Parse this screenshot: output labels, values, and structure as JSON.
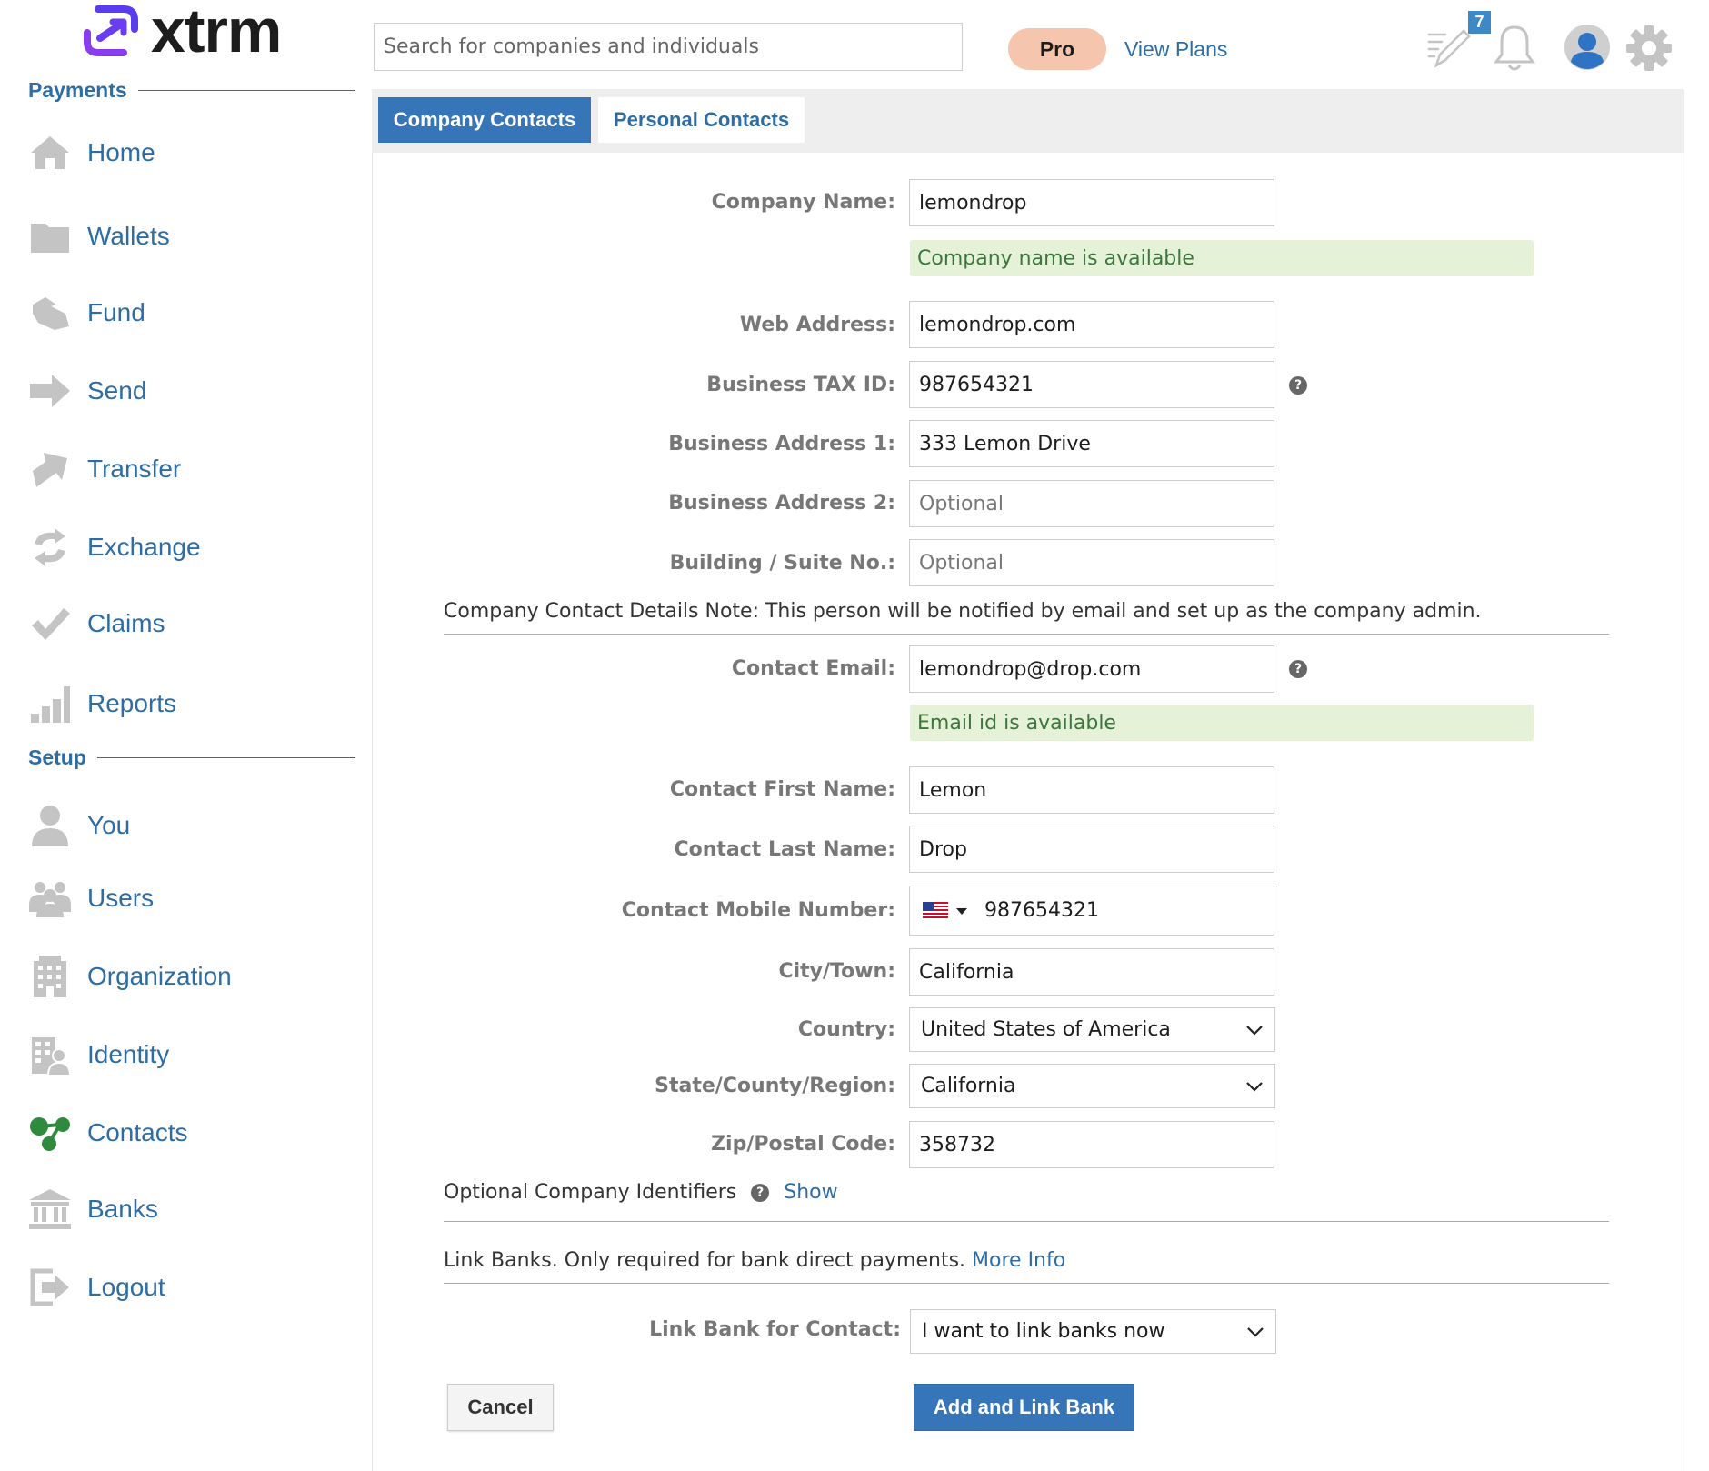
{
  "brand": {
    "name": "xtrm",
    "accent": "#2e6da4",
    "logo_color": "#6a3df0"
  },
  "sidebar": {
    "payments_heading": "Payments",
    "setup_heading": "Setup",
    "payments_items": [
      {
        "label": "Home",
        "icon": "home-icon"
      },
      {
        "label": "Wallets",
        "icon": "folder-icon"
      },
      {
        "label": "Fund",
        "icon": "fund-icon"
      },
      {
        "label": "Send",
        "icon": "send-arrow-icon"
      },
      {
        "label": "Transfer",
        "icon": "transfer-arrow-icon"
      },
      {
        "label": "Exchange",
        "icon": "exchange-icon"
      },
      {
        "label": "Claims",
        "icon": "checkmark-icon"
      },
      {
        "label": "Reports",
        "icon": "bar-chart-icon"
      }
    ],
    "setup_items": [
      {
        "label": "You",
        "icon": "user-icon"
      },
      {
        "label": "Users",
        "icon": "users-icon"
      },
      {
        "label": "Organization",
        "icon": "building-icon"
      },
      {
        "label": "Identity",
        "icon": "identity-icon"
      },
      {
        "label": "Contacts",
        "icon": "contacts-icon",
        "active": true
      },
      {
        "label": "Banks",
        "icon": "bank-icon"
      },
      {
        "label": "Logout",
        "icon": "logout-icon"
      }
    ]
  },
  "header": {
    "search_placeholder": "Search for companies and individuals",
    "plan_label": "Pro",
    "view_plans": "View Plans",
    "notification_count": "7",
    "icons": [
      "edit-notes-icon",
      "bell-icon",
      "profile-icon",
      "gear-icon"
    ]
  },
  "tabs": [
    {
      "label": "Company Contacts",
      "active": true
    },
    {
      "label": "Personal Contacts",
      "active": false
    }
  ],
  "form": {
    "company_name": {
      "label": "Company Name:",
      "value": "lemondrop"
    },
    "company_available": "Company name is available",
    "web_address": {
      "label": "Web Address:",
      "value": "lemondrop.com"
    },
    "tax_id": {
      "label": "Business TAX ID:",
      "value": "987654321"
    },
    "address1": {
      "label": "Business Address 1:",
      "value": "333 Lemon Drive"
    },
    "address2": {
      "label": "Business Address 2:",
      "placeholder": "Optional"
    },
    "suite": {
      "label": "Building / Suite No.:",
      "placeholder": "Optional"
    },
    "contact_details_note": "Company Contact Details  Note: This person will be notified by email and set up as the company admin.",
    "contact_email": {
      "label": "Contact Email:",
      "value": "lemondrop@drop.com"
    },
    "email_available": "Email id is available",
    "first_name": {
      "label": "Contact First Name:",
      "value": "Lemon"
    },
    "last_name": {
      "label": "Contact Last Name:",
      "value": "Drop"
    },
    "mobile": {
      "label": "Contact Mobile Number:",
      "value": "987654321",
      "flag_icon": "us-flag-icon"
    },
    "city": {
      "label": "City/Town:",
      "value": "California"
    },
    "country": {
      "label": "Country:",
      "value": "United States of America"
    },
    "state": {
      "label": "State/County/Region:",
      "value": "California"
    },
    "zip": {
      "label": "Zip/Postal Code:",
      "value": "358732"
    },
    "optional_identifiers": {
      "text": "Optional Company Identifiers",
      "link": "Show"
    },
    "link_banks": {
      "text": "Link Banks. Only required for bank direct payments.",
      "link": "More Info"
    },
    "link_bank_for_contact": {
      "label": "Link Bank for Contact:",
      "value": "I want to link banks now"
    },
    "cancel": "Cancel",
    "submit": "Add and Link Bank"
  },
  "colors": {
    "available_bg": "#e5f2d8",
    "available_text": "#3c763d",
    "pro_pill": "#f5c6ad",
    "primary_button": "#3676b8",
    "contacts_icon": "#2e8b3e"
  }
}
